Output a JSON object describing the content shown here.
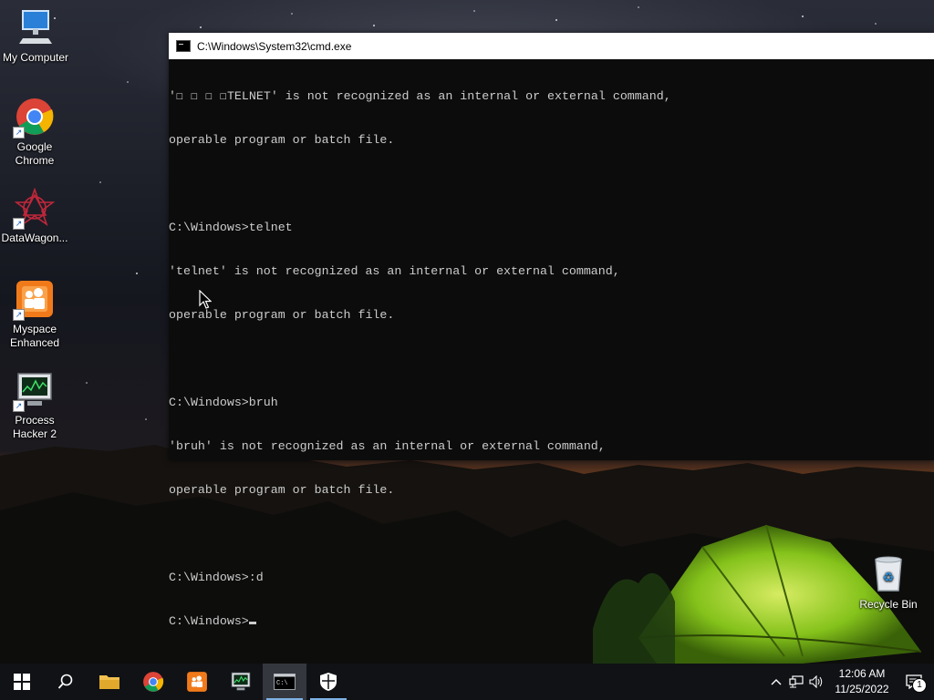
{
  "desktop": {
    "icons": [
      {
        "label": "My Computer"
      },
      {
        "label": "Google Chrome"
      },
      {
        "label": "DataWagon..."
      },
      {
        "label": "Myspace Enhanced"
      },
      {
        "label": "Process Hacker 2"
      },
      {
        "label": "Recycle Bin"
      }
    ]
  },
  "cmd_window": {
    "title": "C:\\Windows\\System32\\cmd.exe",
    "lines": [
      "'☐ ☐ ☐ ☐TELNET' is not recognized as an internal or external command,",
      "operable program or batch file.",
      "",
      "C:\\Windows>telnet",
      "'telnet' is not recognized as an internal or external command,",
      "operable program or batch file.",
      "",
      "C:\\Windows>bruh",
      "'bruh' is not recognized as an internal or external command,",
      "operable program or batch file.",
      "",
      "C:\\Windows>:d",
      "C:\\Windows>"
    ],
    "colors": {
      "background": "#0c0c0c",
      "text": "#cccccc",
      "titlebar": "#ffffff"
    }
  },
  "taskbar": {
    "items": [
      "start-icon",
      "search-icon",
      "file-explorer-icon",
      "chrome-icon",
      "myspace-icon",
      "process-hacker-icon",
      "cmd-icon",
      "security-shield-icon"
    ],
    "clock": {
      "time": "12:06 AM",
      "date": "11/25/2022"
    },
    "notification_count": "1",
    "accent": "#7fb2e6"
  }
}
